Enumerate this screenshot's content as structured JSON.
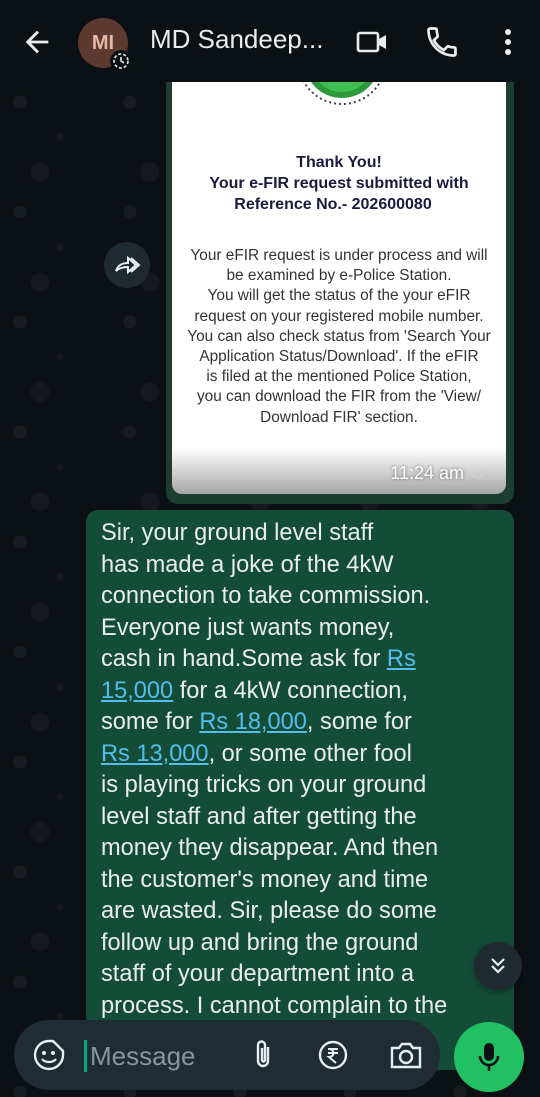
{
  "header": {
    "avatar_initials": "MI",
    "contact_name": "MD Sandeep...",
    "icons": [
      "back-arrow-icon",
      "video-call-icon",
      "voice-call-icon",
      "more-vert-icon"
    ]
  },
  "image_message": {
    "thanks_line1": "Thank You!",
    "thanks_line2": "Your e-FIR request submitted with",
    "thanks_line3": "Reference No.- 202600080",
    "body_lines": [
      "Your eFIR request is under process and will",
      "be examined by e-Police Station.",
      "You will get the status of the your eFIR",
      "request on your registered mobile number.",
      "You can also check status from 'Search Your",
      "Application Status/Download'. If the eFIR",
      "is filed at the mentioned Police Station,",
      "you can download the FIR from the 'View/",
      "Download FIR' section."
    ],
    "time": "11:24 am"
  },
  "text_message": {
    "line1": "Sir, your ground level staff",
    "line2": "has made a joke of the 4kW",
    "line3": "connection to take commission.",
    "line4": "Everyone just wants money,",
    "line5_pre": "cash in hand.Some ask for ",
    "link1a": "Rs",
    "link1b": "15,000",
    "line6_post": " for a 4kW connection,",
    "line7_pre": "some for ",
    "link2": "Rs 18,000",
    "line7_post": ", some for",
    "link3": "Rs 13,000",
    "line8_post": ", or some other fool",
    "line9": "is playing tricks on your ground",
    "line10": "level staff and after getting the",
    "line11": "money they disappear. And then",
    "line12": "the customer's money and time",
    "line13": "are wasted. Sir, please do some",
    "line14": "follow up and bring the ground",
    "line15": "staff of your department into a",
    "line16": "process. I cannot complain to the"
  },
  "composer": {
    "placeholder": "Message"
  },
  "colors": {
    "outgoing_bubble": "#144d37",
    "link": "#53bdeb",
    "mic_button": "#21c063",
    "background": "#0b1014"
  }
}
